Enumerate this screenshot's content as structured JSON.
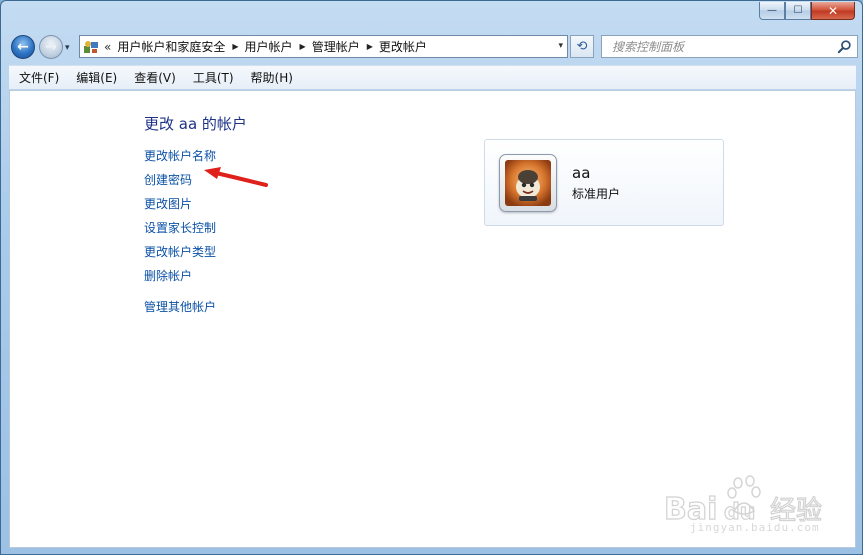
{
  "window": {
    "caption": {
      "minimize": "—",
      "maximize": "☐",
      "close": "✕"
    }
  },
  "nav": {
    "back_glyph": "←",
    "forward_glyph": "→",
    "dropdown_glyph": "▾",
    "address_icon": "control-panel-icon",
    "overflow": "«",
    "breadcrumbs": [
      "用户帐户和家庭安全",
      "用户帐户",
      "管理帐户",
      "更改帐户"
    ],
    "separator": "▶",
    "address_dropdown": "▾",
    "refresh_glyph": "⟲",
    "search": {
      "placeholder": "搜索控制面板",
      "icon": "search-icon"
    }
  },
  "menu": {
    "items": [
      "文件(F)",
      "编辑(E)",
      "查看(V)",
      "工具(T)",
      "帮助(H)"
    ]
  },
  "main": {
    "title": "更改 aa 的帐户",
    "tasks": [
      "更改帐户名称",
      "创建密码",
      "更改图片",
      "设置家长控制",
      "更改帐户类型",
      "删除帐户"
    ],
    "other_link": "管理其他帐户"
  },
  "account": {
    "name": "aa",
    "type": "标准用户",
    "avatar": "user-avatar-icon"
  },
  "annotation": {
    "color": "#e0201b",
    "target": "创建密码"
  },
  "watermark": {
    "logo": "Baidu经验",
    "url": "jingyan.baidu.com"
  },
  "colors": {
    "link": "#0b51a6",
    "title": "#1e3287",
    "chrome": "#aacbeb"
  }
}
